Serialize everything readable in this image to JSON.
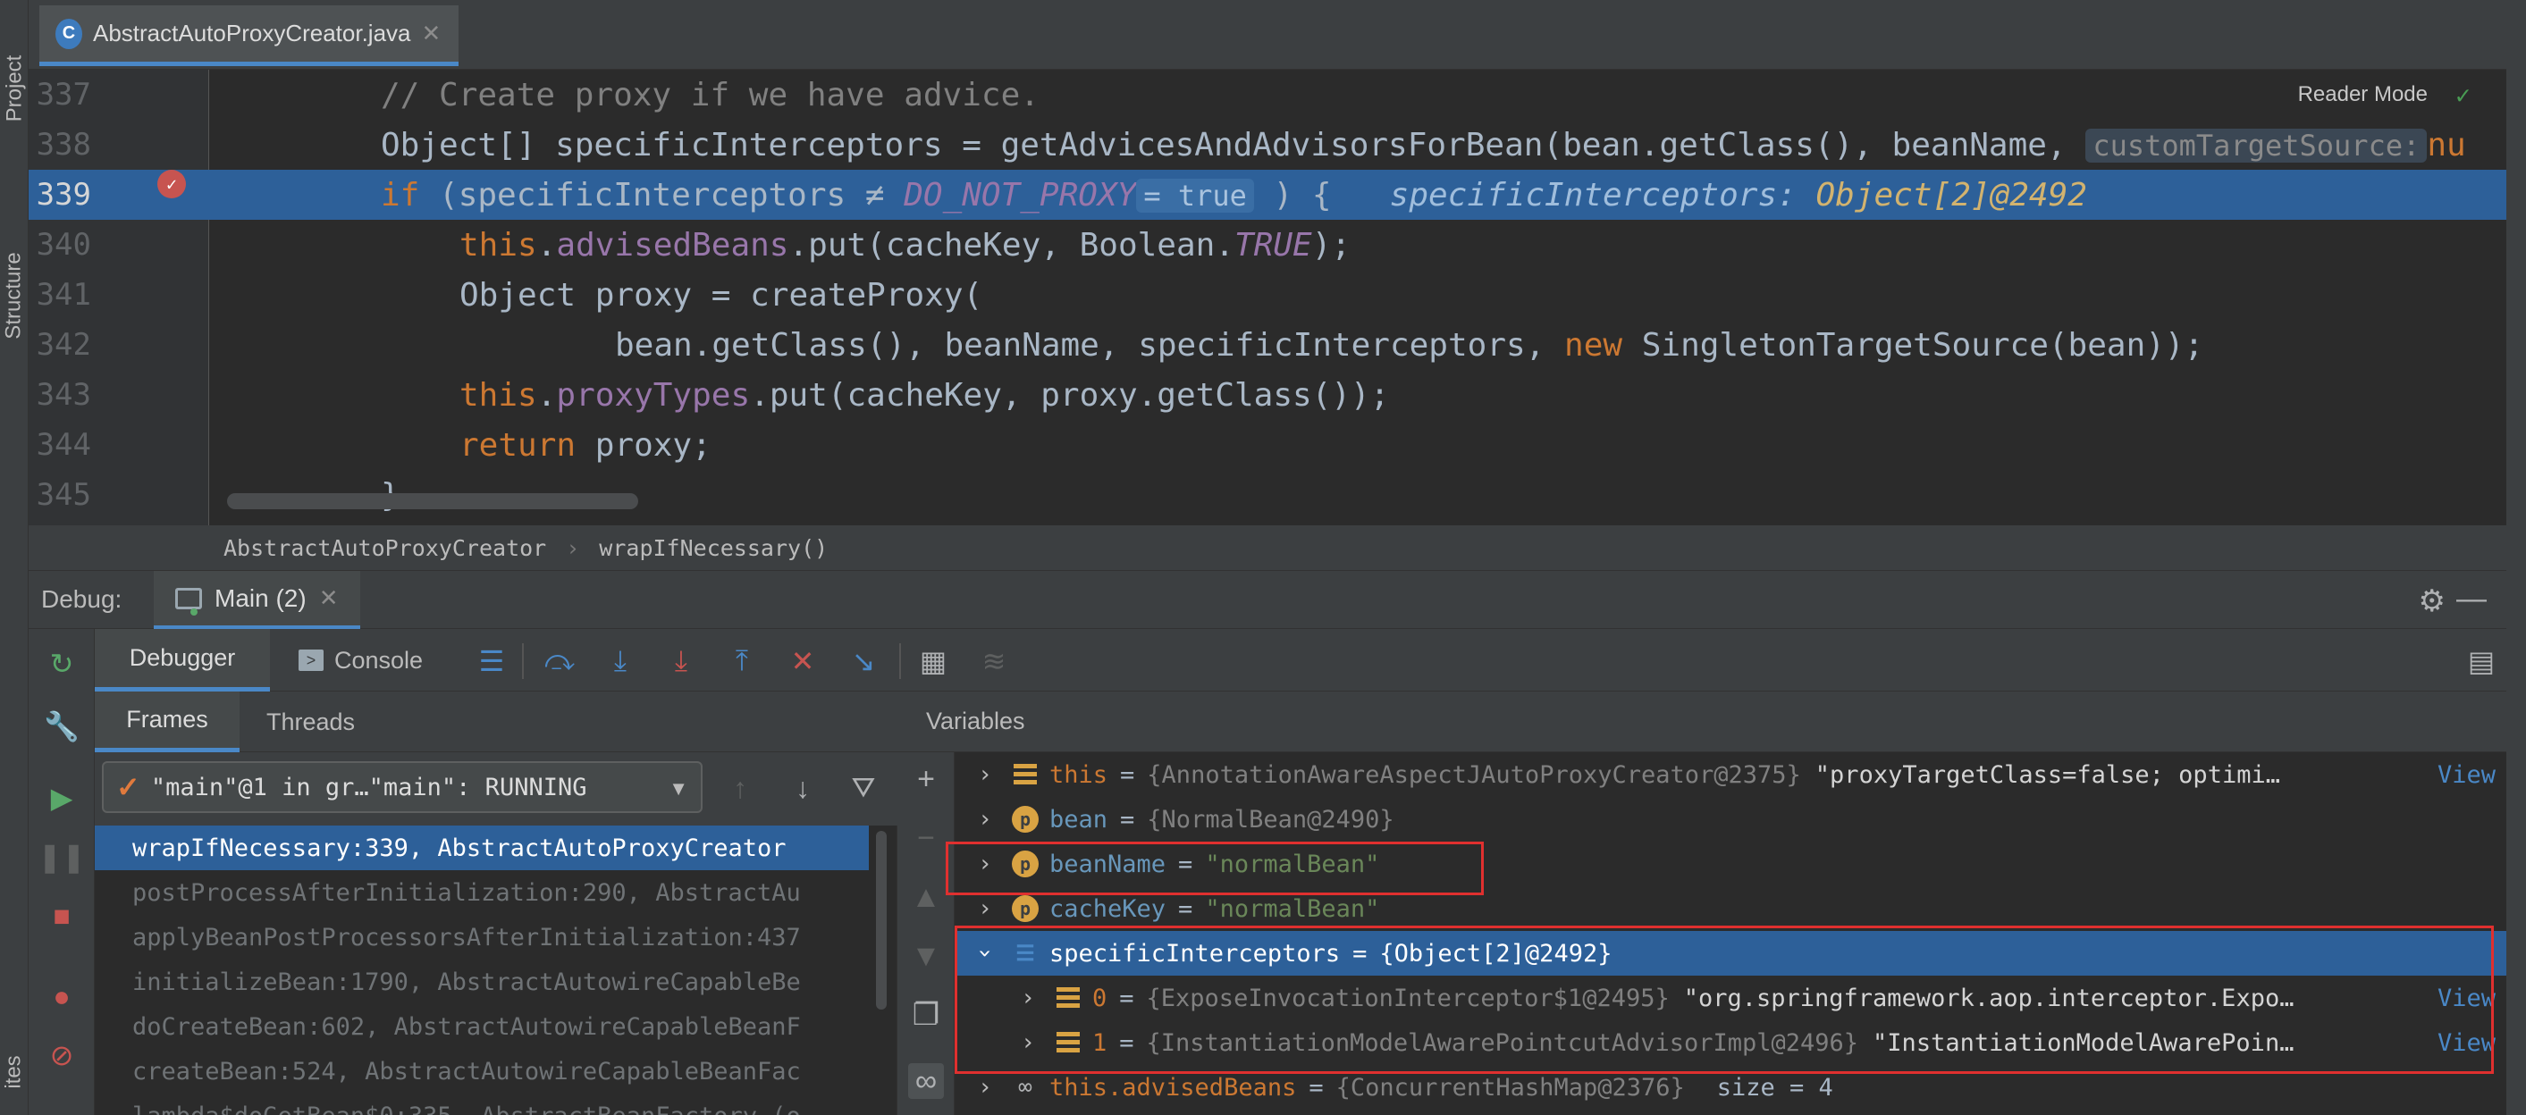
{
  "sidebar_tabs": {
    "project": "Project",
    "structure": "Structure",
    "favorites": "ites"
  },
  "editor": {
    "tab_icon": "C",
    "file_name": "AbstractAutoProxyCreator.java",
    "reader_mode": "Reader Mode",
    "lines": [
      {
        "num": "337"
      },
      {
        "num": "338"
      },
      {
        "num": "339"
      },
      {
        "num": "340"
      },
      {
        "num": "341"
      },
      {
        "num": "342"
      },
      {
        "num": "343"
      },
      {
        "num": "344"
      },
      {
        "num": "345"
      }
    ],
    "code": {
      "l337": "// Create proxy if we have advice.",
      "l338_a": "Object[] specificInterceptors = getAdvicesAndAdvisorsForBean(bean.getClass(), beanName,",
      "l338_hint": "customTargetSource:",
      "l338_tail": "nu",
      "l339_kw": "if",
      "l339_a": " (specificInterceptors ≠ ",
      "l339_const": "DO_NOT_PROXY",
      "l339_hint": "= true",
      "l339_b": " ) {",
      "l339_inline_name": "specificInterceptors:",
      "l339_inline_val": "Object[2]@2492",
      "l340_this": "this",
      "l340_field": "advisedBeans",
      "l340_a": ".put(cacheKey, Boolean.",
      "l340_const": "TRUE",
      "l340_b": ");",
      "l341": "Object proxy = createProxy(",
      "l342_a": "bean.getClass(), beanName, specificInterceptors, ",
      "l342_kw": "new",
      "l342_b": " SingletonTargetSource(bean));",
      "l343_this": "this",
      "l343_field": "proxyTypes",
      "l343_a": ".put(cacheKey, proxy.getClass());",
      "l344_kw": "return",
      "l344_a": " proxy;",
      "l345": "}"
    }
  },
  "breadcrumb": {
    "class": "AbstractAutoProxyCreator",
    "sep": "›",
    "method": "wrapIfNecessary()"
  },
  "debug": {
    "title": "Debug:",
    "session_tab": "Main (2)",
    "tabs": {
      "debugger": "Debugger",
      "console": "Console"
    },
    "frames_tab": "Frames",
    "threads_tab": "Threads",
    "thread_select": "\"main\"@1 in gr…\"main\": RUNNING",
    "frames": [
      "wrapIfNecessary:339, AbstractAutoProxyCreator",
      "postProcessAfterInitialization:290, AbstractAu",
      "applyBeanPostProcessorsAfterInitialization:437",
      "initializeBean:1790, AbstractAutowireCapableBe",
      "doCreateBean:602, AbstractAutowireCapableBeanF",
      "createBean:524, AbstractAutowireCapableBeanFac",
      "lambda$doGetBean$0:335, AbstractBeanFactory (o"
    ],
    "variables_header": "Variables",
    "variables": [
      {
        "name": "this",
        "eq": "=",
        "obj": "{AnnotationAwareAspectJAutoProxyCreator@2375}",
        "desc": "\"proxyTargetClass=false; optimi…",
        "link": "View"
      },
      {
        "name": "bean",
        "eq": "=",
        "obj": "{NormalBean@2490}"
      },
      {
        "name": "beanName",
        "eq": "=",
        "value": "\"normalBean\""
      },
      {
        "name": "cacheKey",
        "eq": "=",
        "value": "\"normalBean\""
      },
      {
        "name": "specificInterceptors",
        "eq": "=",
        "obj": "{Object[2]@2492}"
      },
      {
        "name": "0",
        "eq": "=",
        "obj": "{ExposeInvocationInterceptor$1@2495}",
        "desc": "\"org.springframework.aop.interceptor.Expo…",
        "link": "View"
      },
      {
        "name": "1",
        "eq": "=",
        "obj": "{InstantiationModelAwarePointcutAdvisorImpl@2496}",
        "desc": "\"InstantiationModelAwarePoin…",
        "link": "View"
      },
      {
        "name": "this.advisedBeans",
        "eq": "=",
        "obj": "{ConcurrentHashMap@2376}",
        "size": "size = 4"
      }
    ]
  },
  "colors": {
    "accent": "#4a88c7",
    "selection": "#2d6099",
    "highlight_box": "#e0302f"
  }
}
